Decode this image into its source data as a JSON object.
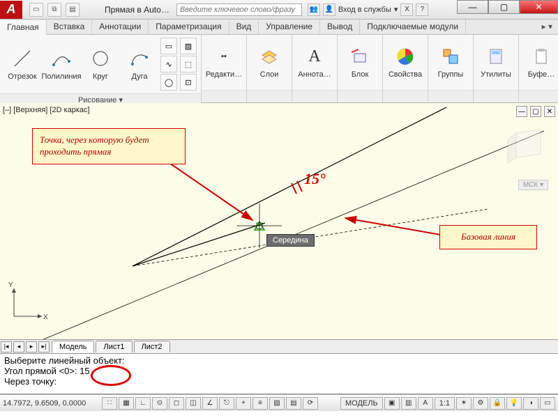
{
  "window": {
    "title": "Прямая в Auto…",
    "search_placeholder": "Введите ключевое слово/фразу",
    "sign_in": "Вход в службы"
  },
  "tabs": [
    "Главная",
    "Вставка",
    "Аннотации",
    "Параметризация",
    "Вид",
    "Управление",
    "Вывод",
    "Подключаемые модули"
  ],
  "active_tab": 0,
  "ribbon": {
    "draw_panel_title": "Рисование ▾",
    "buttons": {
      "line": "Отрезок",
      "polyline": "Полилиния",
      "circle": "Круг",
      "arc": "Дуга",
      "edit": "Редакти…",
      "layers": "Слои",
      "annot": "Аннота…",
      "block": "Блок",
      "props": "Свойства",
      "groups": "Группы",
      "utils": "Утилиты",
      "buffer": "Буфе…"
    }
  },
  "viewport": {
    "label": "[–] [Верхняя] [2D каркас]",
    "snap_tip": "Середина",
    "axis_x": "X",
    "axis_y": "Y",
    "msk": "МСК ▾"
  },
  "callouts": {
    "point": "Точка, через которую будет проходить прямая",
    "base": "Базовая линия",
    "angle": "15°"
  },
  "sheets": {
    "model": "Модель",
    "sheet1": "Лист1",
    "sheet2": "Лист2"
  },
  "cmd": {
    "l1": "Выберите линейный объект:",
    "l2": "Угол прямой <0>: 15",
    "l3": "Через точку:"
  },
  "status": {
    "coords": "14.7972, 9.6509, 0.0000",
    "model": "МОДЕЛЬ",
    "scale": "1:1"
  }
}
